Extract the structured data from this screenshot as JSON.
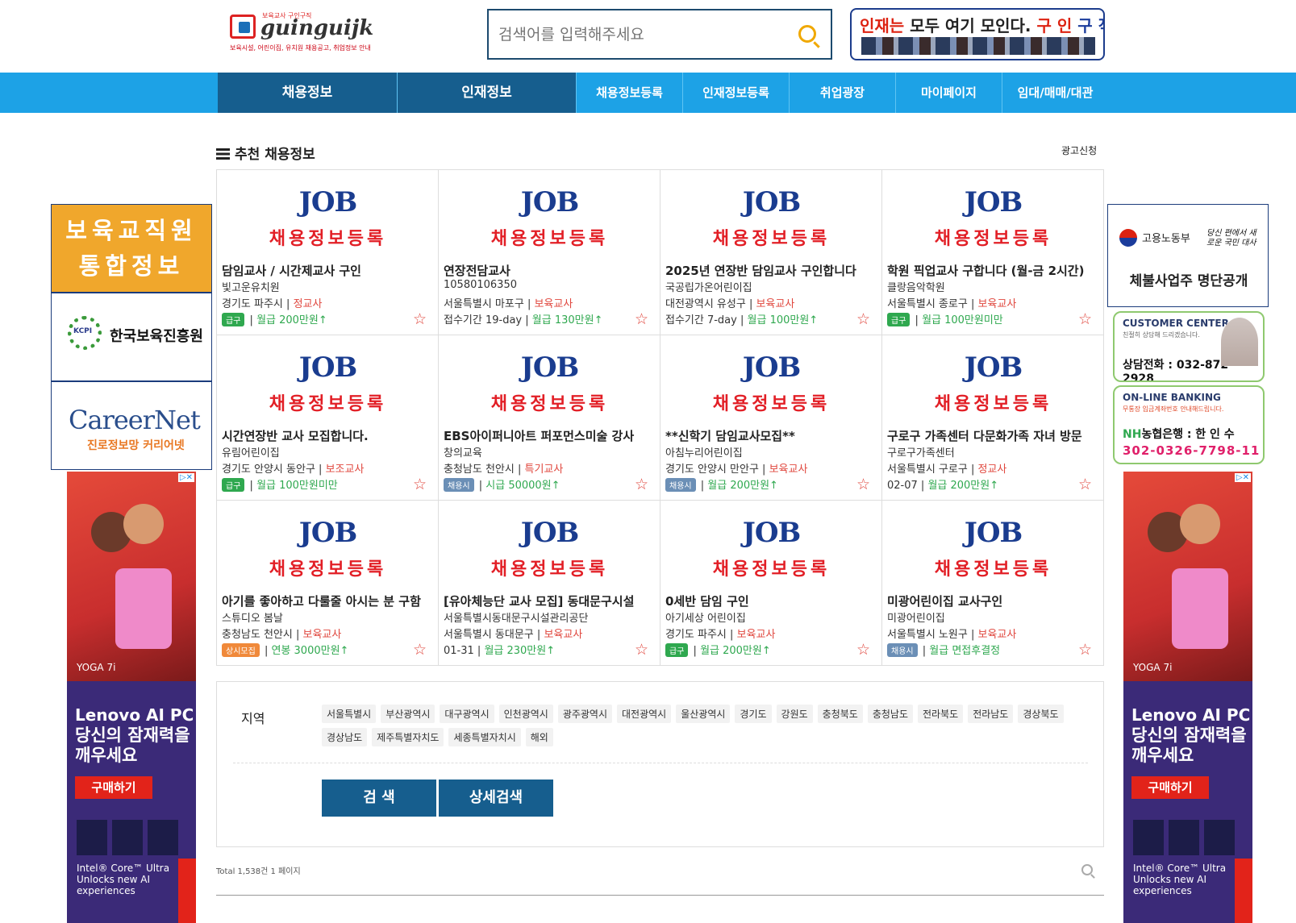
{
  "header": {
    "logo_small": "보육교사 구인구직",
    "logo_brand": "guinguijk",
    "logo_tagline": "보육시설, 어린이집, 유치원 채용공고, 취업정보 안내",
    "search_placeholder": "검색어를 입력해주세요",
    "banner": {
      "p1": "인재는",
      "p2": " 모두 여기 모인다. ",
      "p3": "구 인 ",
      "p4": "구 직"
    }
  },
  "nav": [
    "채용정보",
    "인재정보",
    "채용정보등록",
    "인재정보등록",
    "취업광장",
    "마이페이지",
    "임대/매매/대관"
  ],
  "section": {
    "title": "추천 채용정보",
    "ad_link": "광고신청"
  },
  "card_common": {
    "job": "JOB",
    "register": "채용정보등록"
  },
  "cards": [
    {
      "title": "담임교사 / 시간제교사 구인",
      "company": "빛고운유치원",
      "region": "경기도 파주시",
      "role": "정교사",
      "badge": "급구",
      "badge_type": "urgent",
      "pay": "월급 200만원↑"
    },
    {
      "title": "연장전담교사",
      "company": "10580106350",
      "region": "서울특별시 마포구",
      "role": "보육교사",
      "badge": "접수기간 19-day",
      "badge_type": "text",
      "pay": "월급 130만원↑"
    },
    {
      "title": "2025년 연장반 담임교사 구인합니다",
      "company": "국공립가온어린이집",
      "region": "대전광역시 유성구",
      "role": "보육교사",
      "badge": "접수기간 7-day",
      "badge_type": "text",
      "pay": "월급 100만원↑"
    },
    {
      "title": "학원 픽업교사 구합니다 (월-금 2시간)",
      "company": "클랑음악학원",
      "region": "서울특별시 종로구",
      "role": "보육교사",
      "badge": "급구",
      "badge_type": "urgent",
      "pay": "월급 100만원미만"
    },
    {
      "title": "시간연장반 교사 모집합니다.",
      "company": "유림어린이집",
      "region": "경기도 안양시 동안구",
      "role": "보조교사",
      "badge": "급구",
      "badge_type": "urgent",
      "pay": "월급 100만원미만"
    },
    {
      "title": "EBS아이퍼니아트 퍼포먼스미술 강사",
      "company": "창의교육",
      "region": "충청남도 천안시",
      "role": "특기교사",
      "badge": "채용시",
      "badge_type": "hire",
      "pay": "시급 50000원↑"
    },
    {
      "title": "**신학기 담임교사모집**",
      "company": "아침누리어린이집",
      "region": "경기도 안양시 만안구",
      "role": "보육교사",
      "badge": "채용시",
      "badge_type": "hire",
      "pay": "월급 200만원↑"
    },
    {
      "title": "구로구 가족센터 다문화가족 자녀 방문",
      "company": "구로구가족센터",
      "region": "서울특별시 구로구",
      "role": "정교사",
      "badge": "02-07",
      "badge_type": "text",
      "pay": "월급 200만원↑"
    },
    {
      "title": "아기를 좋아하고 다룰줄 아시는 분 구함",
      "company": "스튜디오 봄날",
      "region": "충청남도 천안시",
      "role": "보육교사",
      "badge": "상시모집",
      "badge_type": "always",
      "pay": "연봉 3000만원↑"
    },
    {
      "title": "[유아체능단 교사 모집] 동대문구시설",
      "company": "서울특별시동대문구시설관리공단",
      "region": "서울특별시 동대문구",
      "role": "보육교사",
      "badge": "01-31",
      "badge_type": "text",
      "pay": "월급 230만원↑"
    },
    {
      "title": "0세반 담임 구인",
      "company": "아기세상 어린이집",
      "region": "경기도 파주시",
      "role": "보육교사",
      "badge": "급구",
      "badge_type": "urgent",
      "pay": "월급 200만원↑"
    },
    {
      "title": "미광어린이집 교사구인",
      "company": "미광어린이집",
      "region": "서울특별시 노원구",
      "role": "보육교사",
      "badge": "채용시",
      "badge_type": "hire",
      "pay": "월급 면접후결정"
    }
  ],
  "left_ads": {
    "integrated": "보육교직원 통합정보",
    "kcpi": "한국보육진흥원",
    "career_net": "CareerNet",
    "career_sub1": "진로정보망 ",
    "career_sub2": "커리어넷"
  },
  "lenovo": {
    "yoga": "YOGA 7i",
    "headline": "Lenovo AI PC",
    "sub": "당신의 잠재력을 깨우세요",
    "buy": "구매하기",
    "tag": "Intel® Core™ Ultra Unlocks new AI experiences"
  },
  "right_ads": {
    "ministry": "고용노동부",
    "slogan": "당신 편에서 새로운 국민 대사",
    "unpaid": "체불사업주 명단공개",
    "cc_title": "CUSTOMER CENTER",
    "cc_sub": "친절히 상담해 드리겠습니다.",
    "cc_tel": "상담전화 : 032-872-2928",
    "bank_title": "ON-LINE BANKING",
    "bank_sub": "무통장 입금계좌번호 안내해드립니다.",
    "bank_nh": "NH",
    "bank_name": "농협은행 : 한 인 수",
    "bank_acc": "302-0326-7798-11"
  },
  "filter": {
    "label": "지역",
    "regions": [
      "서울특별시",
      "부산광역시",
      "대구광역시",
      "인천광역시",
      "광주광역시",
      "대전광역시",
      "울산광역시",
      "경기도",
      "강원도",
      "충청북도",
      "충청남도",
      "전라북도",
      "전라남도",
      "경상북도",
      "경상남도",
      "제주특별자치도",
      "세종특별자치시",
      "해외"
    ],
    "search_btn": "검  색",
    "detail_btn": "상세검색"
  },
  "total": "Total 1,538건 1 페이지"
}
